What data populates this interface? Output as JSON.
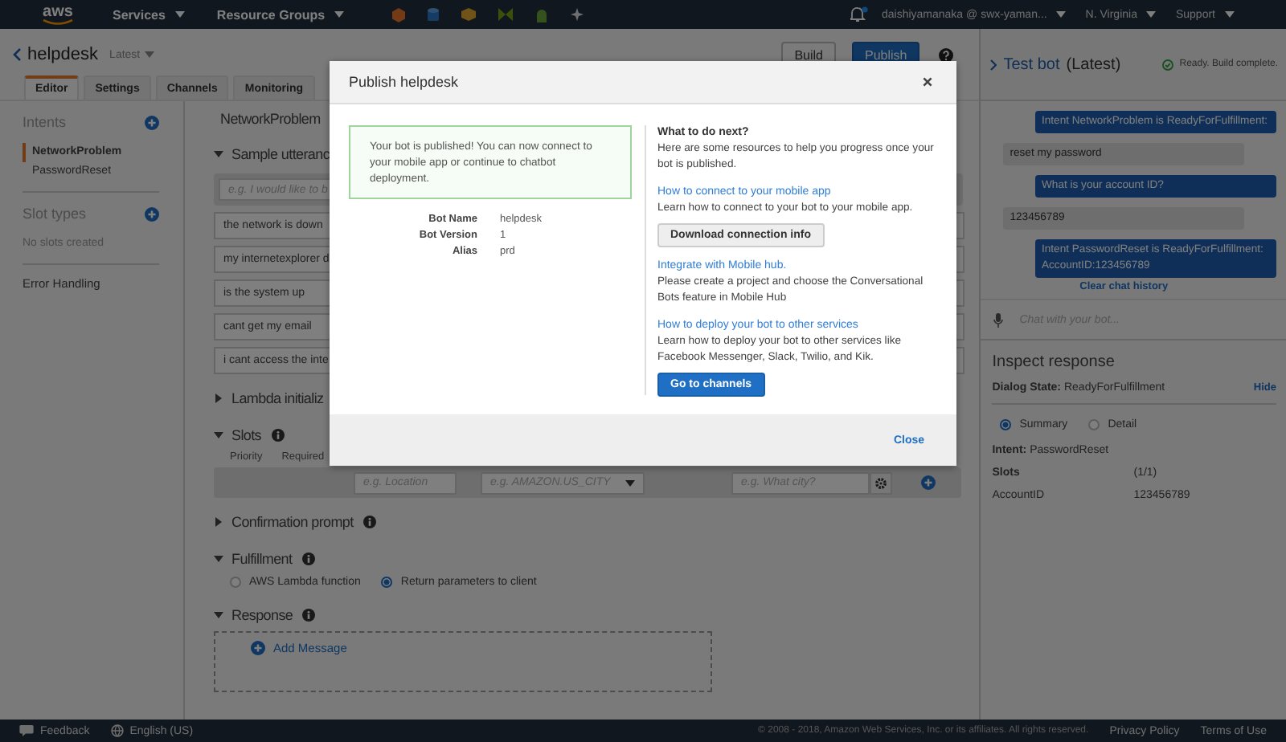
{
  "top_nav": {
    "logo": "aws",
    "menus": [
      {
        "label": "Services"
      },
      {
        "label": "Resource Groups"
      }
    ],
    "account": "daishiyamanaka @ swx-yaman...",
    "region": "N. Virginia",
    "support": "Support"
  },
  "bot_header": {
    "name": "helpdesk",
    "version": "Latest",
    "buttons": [
      "Build",
      "Publish"
    ]
  },
  "tabs": [
    {
      "label": "Editor",
      "selected": true
    },
    {
      "label": "Settings",
      "selected": false
    },
    {
      "label": "Channels",
      "selected": false
    },
    {
      "label": "Monitoring",
      "selected": false
    }
  ],
  "sidebar": [
    {
      "kind": "list",
      "title": "Intents",
      "items": [
        {
          "label": "NetworkProblem",
          "selected": true
        },
        {
          "label": "PasswordReset",
          "selected": false
        }
      ]
    },
    {
      "kind": "empty",
      "title": "Slot types",
      "message": "No slots created"
    },
    {
      "kind": "link",
      "title": "Error Handling"
    }
  ],
  "editor": {
    "intent_title": "NetworkProblem",
    "sections": [
      {
        "kind": "utterances",
        "title": "Sample utteranc",
        "expanded": true,
        "info": false,
        "placeholder": "e.g. I would like to b",
        "items": [
          "the network is down",
          "my internetexplorer d",
          "is the system up",
          "cant get my email",
          "i cant access the inte"
        ]
      },
      {
        "kind": "plain",
        "title": "Lambda initializ",
        "expanded": false,
        "info": false
      },
      {
        "kind": "slots",
        "title": "Slots",
        "expanded": true,
        "info": true,
        "columns": [
          "Priority",
          "Required"
        ],
        "name_placeholder": "e.g. Location",
        "type_placeholder": "e.g. AMAZON.US_CITY",
        "prompt_placeholder": "e.g. What city?"
      },
      {
        "kind": "plain",
        "title": "Confirmation prompt",
        "expanded": false,
        "info": true
      },
      {
        "kind": "radios",
        "title": "Fulfillment",
        "expanded": true,
        "info": true,
        "options": [
          {
            "label": "AWS Lambda function",
            "selected": false
          },
          {
            "label": "Return parameters to client",
            "selected": true
          }
        ]
      },
      {
        "kind": "response",
        "title": "Response",
        "expanded": true,
        "info": true,
        "action": "Add Message"
      }
    ]
  },
  "test_bot": {
    "title": "Test bot",
    "suffix": "(Latest)",
    "status": "Ready. Build complete.",
    "messages": [
      {
        "kind": "bot",
        "text": "Intent NetworkProblem is ReadyForFulfillment:"
      },
      {
        "kind": "user",
        "text": "reset my password"
      },
      {
        "kind": "bot",
        "text": "What is your account ID?"
      },
      {
        "kind": "user",
        "text": "123456789"
      },
      {
        "kind": "bot",
        "text": "Intent PasswordReset is ReadyForFulfillment: AccountID:123456789"
      }
    ],
    "clear": "Clear chat history",
    "chat_placeholder": "Chat with your bot...",
    "inspect": {
      "title": "Inspect response",
      "state_label": "Dialog State:",
      "state_value": "ReadyForFulfillment",
      "hide": "Hide",
      "views": [
        {
          "label": "Summary",
          "selected": true
        },
        {
          "label": "Detail",
          "selected": false
        }
      ],
      "intent_label": "Intent:",
      "intent_value": "PasswordReset",
      "slots_label": "Slots",
      "slots_count": "(1/1)",
      "slots": [
        {
          "name": "AccountID",
          "value": "123456789"
        }
      ]
    }
  },
  "modal": {
    "title": "Publish helpdesk",
    "message": "Your bot is published! You can now connect to your mobile app or continue to chatbot deployment.",
    "details": [
      {
        "label": "Bot Name",
        "value": "helpdesk"
      },
      {
        "label": "Bot Version",
        "value": "1"
      },
      {
        "label": "Alias",
        "value": "prd"
      }
    ],
    "next_title": "What to do next?",
    "next_intro": "Here are some resources to help you progress once your bot is published.",
    "resources": [
      {
        "link": "How to connect to your mobile app",
        "text": "Learn how to connect to your bot to your mobile app.",
        "button": "Download connection info",
        "primary": false
      },
      {
        "link": "Integrate with Mobile hub.",
        "text": "Please create a project and choose the Conversational Bots feature in Mobile Hub"
      },
      {
        "link": "How to deploy your bot to other services",
        "text": "Learn how to deploy your bot to other services like Facebook Messenger, Slack, Twilio, and Kik.",
        "button": "Go to channels",
        "primary": true
      }
    ],
    "close": "Close"
  },
  "footer": {
    "feedback": "Feedback",
    "language": "English (US)",
    "copyright": "© 2008 - 2018, Amazon Web Services, Inc. or its affiliates. All rights reserved.",
    "links": [
      "Privacy Policy",
      "Terms of Use"
    ]
  }
}
